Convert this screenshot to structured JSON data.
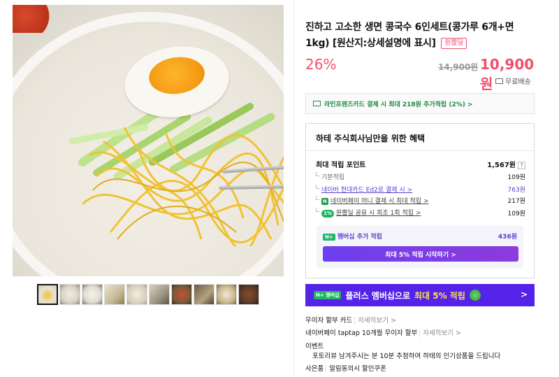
{
  "product": {
    "title": "진하고 고소한 생면 콩국수 6인세트(콩가루 6개+면1kg) [원산지:상세설명에 표시]",
    "badge": "원쁠딜",
    "discount": "26%",
    "original_price": "14,900원",
    "sale_price": "10,900원",
    "shipping": "무료배송"
  },
  "card_banner": "라인프렌즈카드 결제 시 최대 218원 추가적립 (2%) >",
  "benefits": {
    "title": "하테 주식회사님만을 위한 혜택",
    "max_points_label": "최대 적립 포인트",
    "max_points_value": "1,567원",
    "help": "?",
    "rows": [
      {
        "label": "기본적립",
        "value": "109원"
      },
      {
        "label": "네이버 현대카드 Ed2로 결제 시 >",
        "value": "763원"
      },
      {
        "label": "네이버페이 머니 결제 시 최대 적립 >",
        "value": "217원",
        "badge": "N"
      },
      {
        "label": "원쁠딜 공유 시 최초 1회 적립 >",
        "value": "109원",
        "badge": "1%"
      }
    ],
    "membership_label": "멤버십 추가 적립",
    "membership_value": "436원",
    "membership_badge": "N+",
    "membership_button": "최대 5% 적립 시작하기 >"
  },
  "plus_banner": {
    "tag": "N+ 멤버십",
    "text_a": "플러스 멤버십으로",
    "text_b": "최대 5% 적립",
    "arrow": ">"
  },
  "info": {
    "card_installment": "무이자 할부 카드",
    "card_more": "자세히보기 >",
    "naverpay_installment": "네이버페이 taptap 10개월 무이자 할부",
    "naverpay_more": "자세히보기 >",
    "event_label": "이벤트",
    "event_desc": "포토리뷰 남겨주시는 분 10분 추첨하여 하테의 인기상품을 드립니다",
    "gift_label": "사은품",
    "gift_desc": "알림동의시 할인쿠폰"
  },
  "colors": {
    "accent": "#f34e6b",
    "naver_green": "#1c8b3f",
    "membership_purple": "#5522ea"
  }
}
